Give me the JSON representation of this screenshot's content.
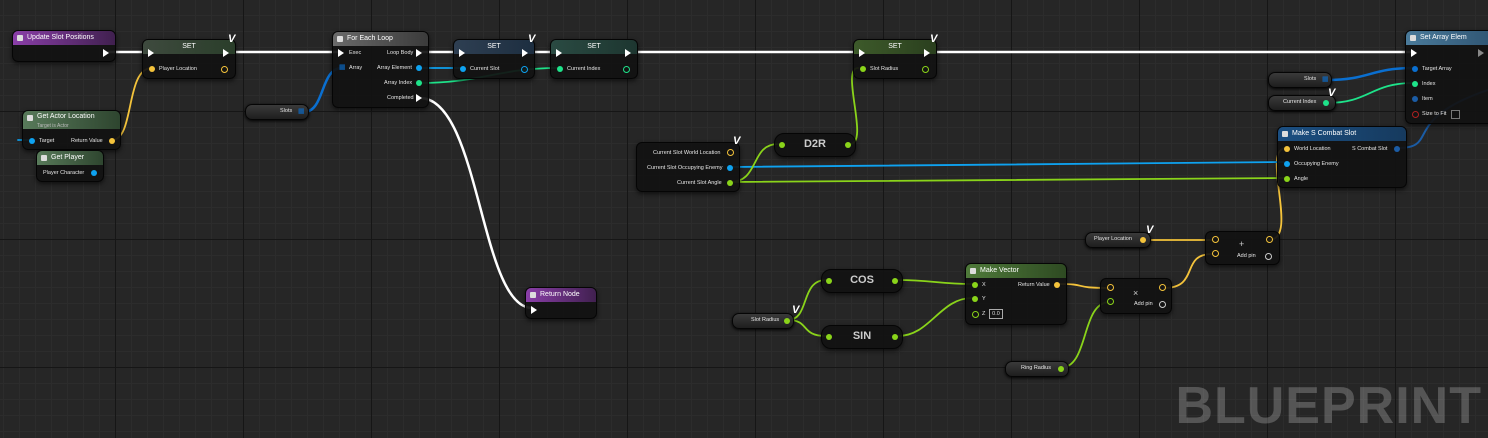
{
  "watermark": "BLUEPRINT",
  "colors": {
    "exec": "#ffffff",
    "vector": "#f4c33b",
    "object": "#0ea2f0",
    "int": "#1ee38a",
    "float": "#8ad41a",
    "struct": "#1b5ca5"
  },
  "nodes": {
    "update_slot_positions": {
      "title": "Update Slot Positions"
    },
    "set1": {
      "title": "SET",
      "pin_in": "Player Location"
    },
    "get_actor_location": {
      "title": "Get Actor Location",
      "subtitle": "Target is Actor",
      "target": "Target",
      "return": "Return Value"
    },
    "get_player": {
      "title": "Get Player",
      "out": "Player Character"
    },
    "slots_var1": {
      "label": "Slots"
    },
    "for_each": {
      "title": "For Each Loop",
      "exec": "Exec",
      "array": "Array",
      "loop_body": "Loop Body",
      "array_element": "Array Element",
      "array_index": "Array Index",
      "completed": "Completed"
    },
    "set2": {
      "title": "SET",
      "pin_in": "Current Slot"
    },
    "set3": {
      "title": "SET",
      "pin_in": "Current Index"
    },
    "set4": {
      "title": "SET",
      "pin_in": "Slot Radius"
    },
    "return_node": {
      "title": "Return Node"
    },
    "break_slot": {
      "world_location": "Current Slot World Location",
      "occupying_enemy": "Current Slot Occupying Enemy",
      "angle": "Current Slot Angle"
    },
    "d2r": {
      "label": "D2R"
    },
    "cos": {
      "label": "COS"
    },
    "sin": {
      "label": "SIN"
    },
    "slot_radius_var": {
      "label": "Slot Radius"
    },
    "make_vector": {
      "title": "Make Vector",
      "x": "X",
      "y": "Y",
      "z": "Z",
      "z_value": "0.0",
      "return": "Return Value"
    },
    "ring_radius_var": {
      "label": "Ring Radius"
    },
    "mult": {
      "symbol": "×",
      "add_pin": "Add pin"
    },
    "player_location_var": {
      "label": "Player Location"
    },
    "add": {
      "symbol": "+",
      "add_pin": "Add pin"
    },
    "make_combat_slot": {
      "title": "Make S Combat Slot",
      "world_location": "World Location",
      "occupying_enemy": "Occupying Enemy",
      "angle": "Angle",
      "out": "S Combat Slot"
    },
    "set_array_elem": {
      "title": "Set Array Elem",
      "target_array": "Target Array",
      "index": "Index",
      "item": "Item",
      "size_to_fit": "Size to Fit"
    },
    "slots_var2": {
      "label": "Slots"
    },
    "current_index_var": {
      "label": "Current Index"
    }
  }
}
